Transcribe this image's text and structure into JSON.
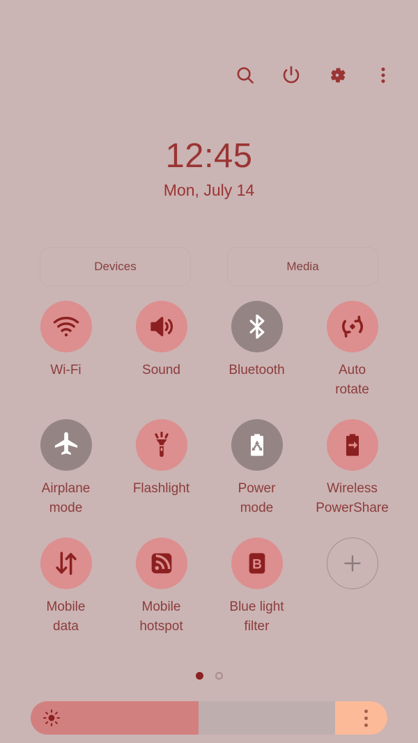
{
  "header": {
    "icons": [
      {
        "name": "search-icon",
        "label": "Search"
      },
      {
        "name": "power-icon",
        "label": "Power off"
      },
      {
        "name": "settings-gear-icon",
        "label": "Settings"
      },
      {
        "name": "more-options-icon",
        "label": "More options"
      }
    ]
  },
  "clock": {
    "time": "12:45",
    "date": "Mon, July 14"
  },
  "pills": {
    "devices_label": "Devices",
    "media_label": "Media"
  },
  "quick_settings": {
    "tiles": [
      {
        "label": "Wi-Fi",
        "icon": "wifi-icon",
        "state": "on"
      },
      {
        "label": "Sound",
        "icon": "sound-icon",
        "state": "on"
      },
      {
        "label": "Bluetooth",
        "icon": "bluetooth-icon",
        "state": "off"
      },
      {
        "label": "Auto\nrotate",
        "icon": "auto-rotate-icon",
        "state": "on"
      },
      {
        "label": "Airplane\nmode",
        "icon": "airplane-icon",
        "state": "off"
      },
      {
        "label": "Flashlight",
        "icon": "flashlight-icon",
        "state": "on"
      },
      {
        "label": "Power\nmode",
        "icon": "power-mode-icon",
        "state": "off"
      },
      {
        "label": "Wireless\nPowerShare",
        "icon": "power-share-icon",
        "state": "on"
      },
      {
        "label": "Mobile\ndata",
        "icon": "mobile-data-icon",
        "state": "on"
      },
      {
        "label": "Mobile\nhotspot",
        "icon": "mobile-hotspot-icon",
        "state": "on"
      },
      {
        "label": "Blue light\nfilter",
        "icon": "blue-light-filter-icon",
        "state": "on"
      },
      {
        "label": "",
        "icon": "plus-icon",
        "state": "add"
      }
    ]
  },
  "pagination": {
    "pages": 2,
    "current_page": 1
  },
  "brightness": {
    "value_percent": 47,
    "icon": "brightness-sun-icon",
    "menu_icon": "brightness-options-icon"
  },
  "colors": {
    "background": "#cbb4b4",
    "accent_text": "#9a3534",
    "tile_on": "#dd8e8e",
    "tile_off": "#948584",
    "icon_on": "#8c2020",
    "icon_off": "#ffffff",
    "slider_fill": "#d2807f",
    "slider_track": "#bfaeae",
    "slider_menu": "#fcba99"
  }
}
